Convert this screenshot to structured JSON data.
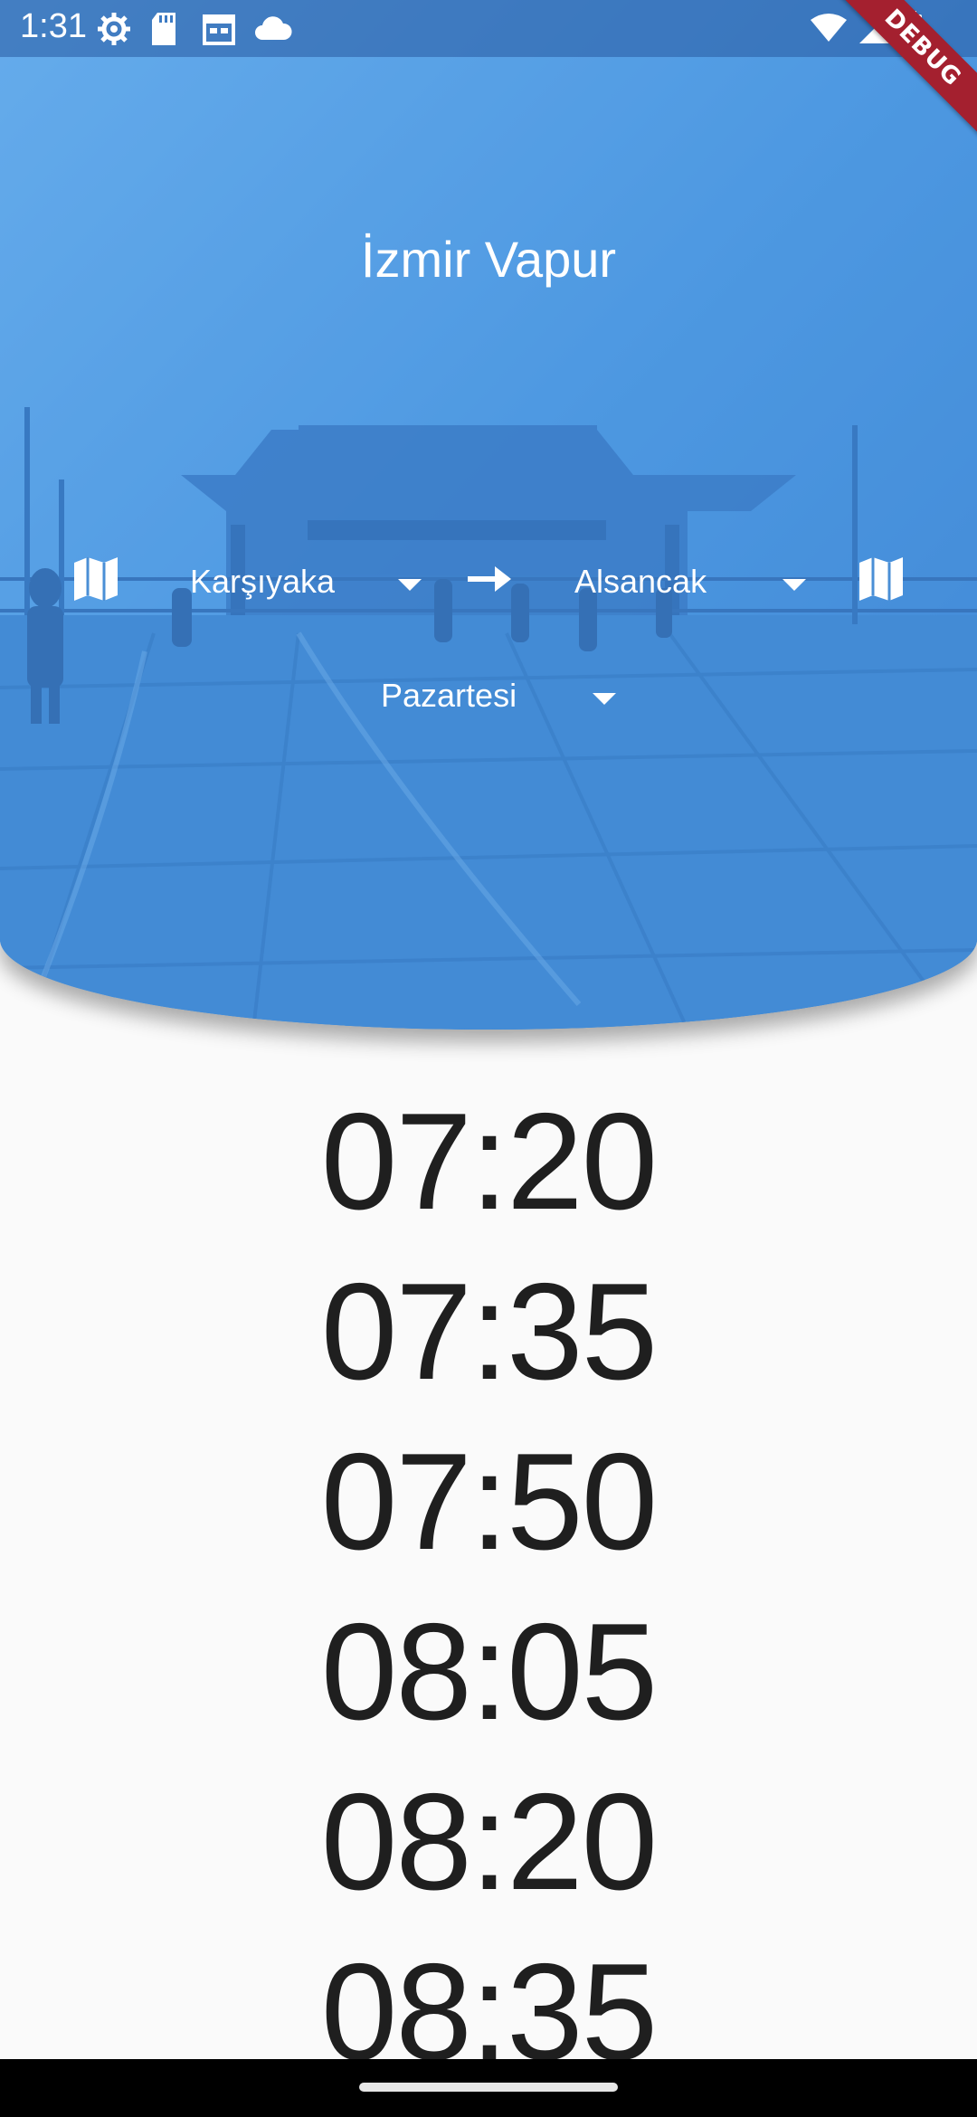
{
  "status_bar": {
    "time": "1:31",
    "left_icons": [
      "settings-icon",
      "sd-card-icon",
      "calendar-icon",
      "cloud-icon"
    ],
    "right_icons": [
      "wifi-icon",
      "signal-icon",
      "battery-icon"
    ]
  },
  "debug_banner": "DEBUG",
  "header": {
    "title": "İzmir Vapur",
    "from_pier": "Karşıyaka",
    "to_pier": "Alsancak",
    "day": "Pazartesi",
    "accent_color": "#4a97e0"
  },
  "times": [
    "07:20",
    "07:35",
    "07:50",
    "08:05",
    "08:20",
    "08:35"
  ]
}
